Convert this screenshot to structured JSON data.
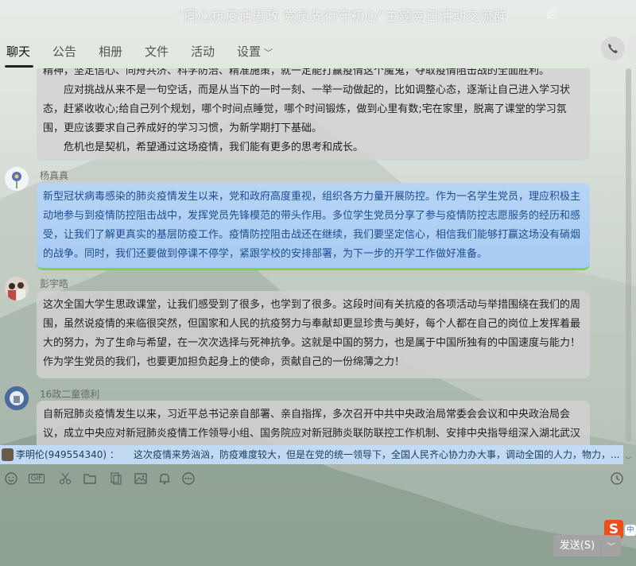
{
  "window": {
    "title": "“同心抗疫话思政 党员先行守初心”主题党日活动交流群"
  },
  "tabs": [
    {
      "label": "聊天"
    },
    {
      "label": "公告"
    },
    {
      "label": "相册"
    },
    {
      "label": "文件"
    },
    {
      "label": "活动"
    },
    {
      "label": "设置"
    }
  ],
  "messages": {
    "first": {
      "lines": [
        "精神，坚定信心、同舟共济、科学防治、精准施策，就一定能打赢疫情这个魔鬼，夺取疫情阻击战的全面胜利。",
        "应对挑战从来不是一句空话，而是从当下的一时一刻、一举一动做起的，比如调整心态，逐渐让自己进入学习状态，赶紧收收心;给自己列个规划，哪个时间点睡觉，哪个时间锻炼，做到心里有数;宅在家里，脱离了课堂的学习氛围，更应该要求自己养成好的学习习惯，为新学期打下基础。",
        "危机也是契机，希望通过这场疫情，我们能有更多的思考和成长。"
      ]
    },
    "yang": {
      "sender": "杨真真",
      "text": "新型冠状病毒感染的肺炎疫情发生以来，党和政府高度重视，组织各方力量开展防控。作为一名学生党员，理应积极主动地参与到疫情防控阻击战中，发挥党员先锋模范的带头作用。多位学生党员分享了参与疫情防控志愿服务的经历和感受，让我们了解更真实的基层防疫工作。疫情防控阻击战还在继续，我们要坚定信心，相信我们能够打赢这场没有硝烟的战争。同时，我们还要做到停课不停学，紧跟学校的安排部署，为下一步的开学工作做好准备。"
    },
    "peng": {
      "sender": "彭宇晧",
      "text": "这次全国大学生思政课堂，让我们感受到了很多，也学到了很多。这段时间有关抗疫的各项活动与举措围绕在我们的周围，虽然说疫情的来临很突然，但国家和人民的抗疫努力与奉献却更显珍贵与美好，每个人都在自己的岗位上发挥着最大的努力，为了生命与希望，在一次次选择与死神抗争。这就是中国的努力，也是属于中国所独有的中国速度与能力！作为学生党员的我们，也要更加担负起身上的使命，贡献自己的一份绵薄之力！"
    },
    "tong": {
      "sender": "16政二童德利",
      "text": "自新冠肺炎疫情发生以来，习近平总书记亲自部署、亲自指挥，多次召开中共中央政治局常委会会议和中央政治局会议，成立中央应对新冠肺炎疫情工作领导小组、国务院应对新冠肺炎联防联控工作机制、安排中央指导组深入湖北武汉斗争一"
    }
  },
  "notice": {
    "sender": "李明伦(949554340) ：",
    "text": "这次疫情来势汹汹，防疫难度较大，但是在党的统一领导下，全国人民齐心协力办大事，调动全国的人力，物力，..."
  },
  "toolbar": {
    "icons": [
      "emoji-icon",
      "gif-icon",
      "scissors-icon",
      "folder-icon",
      "doc-icon",
      "image-icon",
      "bell-icon",
      "more-icon",
      "history-icon"
    ],
    "gif_label": "GIF"
  },
  "send": {
    "label": "发送(S)"
  },
  "ime": {
    "label": "S",
    "tail": "中"
  },
  "colors": {
    "bubble_gray": "#d2d2d2",
    "bubble_blue": "#b7d4f5",
    "bubble_blue_text": "#1e4f8f",
    "send_button": "#a3a3a3",
    "notice_bg": "#c6def8"
  }
}
